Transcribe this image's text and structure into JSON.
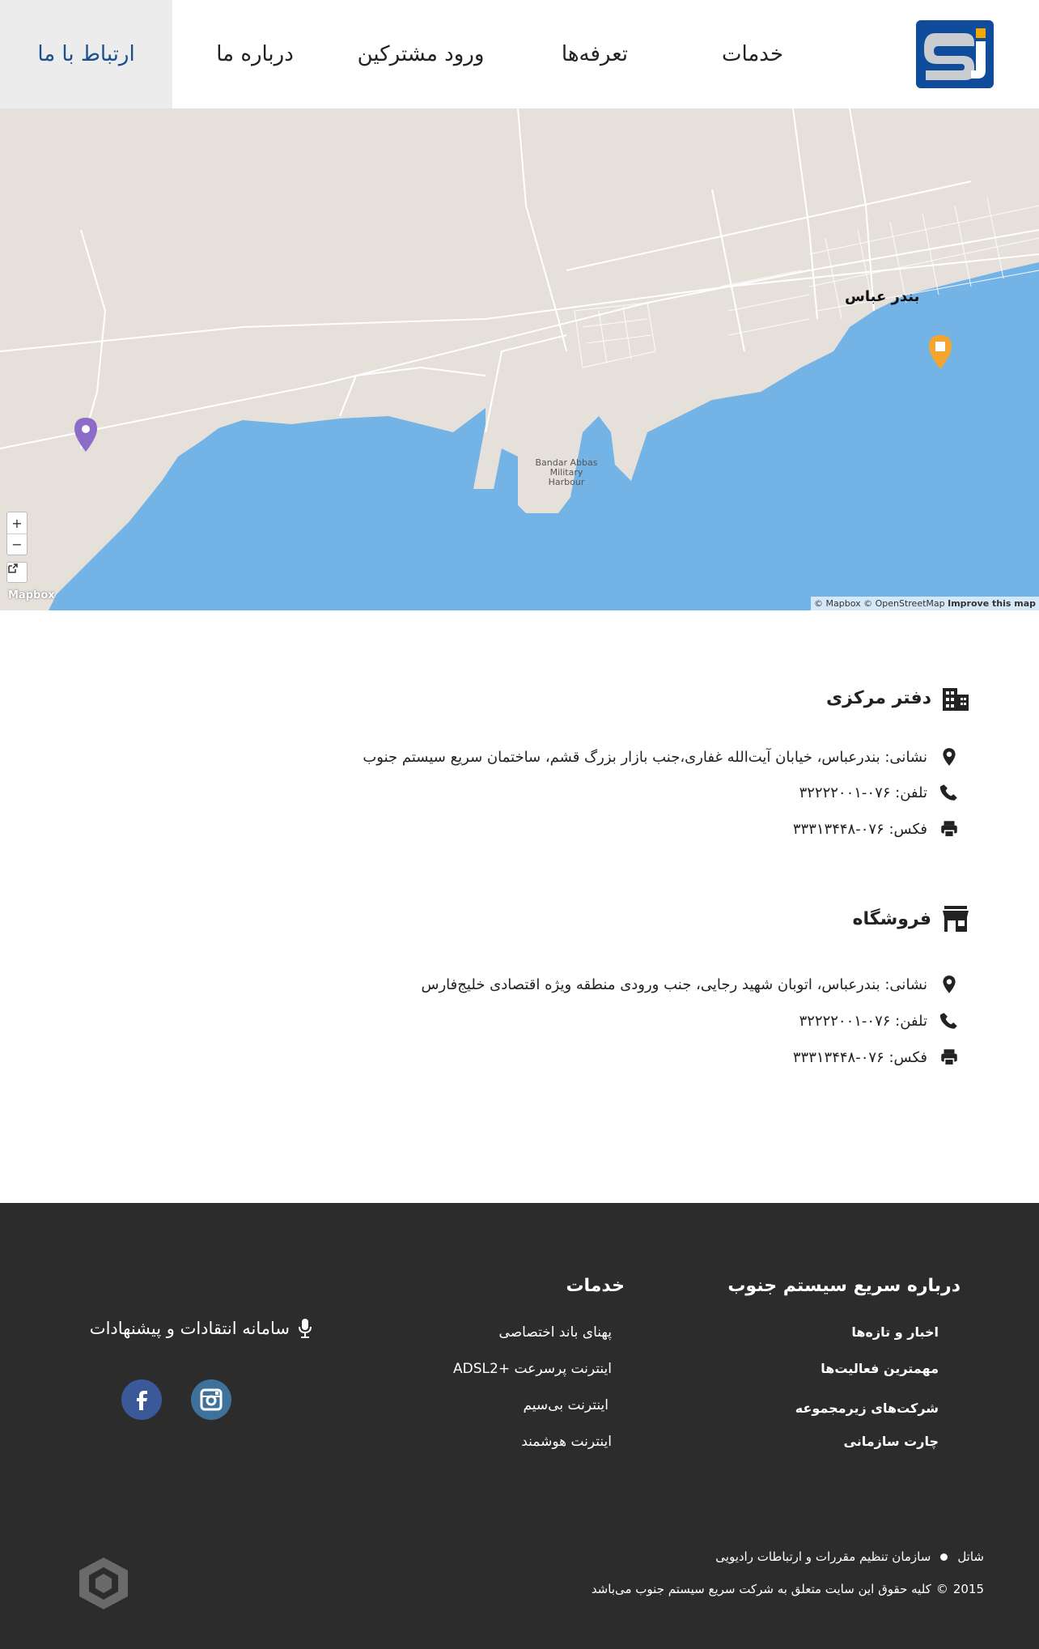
{
  "nav": {
    "items": [
      "ارتباط با ما",
      "درباره ما",
      "ورود مشترکین",
      "تعرفه‌ها",
      "خدمات"
    ],
    "active": "ارتباط با ما"
  },
  "logo": {
    "colors": {
      "bg": "#0f4c9b",
      "accent": "#f2a900"
    }
  },
  "map": {
    "city_label": "بندر عباس",
    "harbour_label": "Bandar Abbas Military Harbour",
    "zoom_in": "+",
    "zoom_out": "−",
    "logo_text": "Mapbox",
    "attribution_mapbox": "© Mapbox",
    "attribution_osm": "© OpenStreetMap",
    "attribution_improve": "Improve this map",
    "colors": {
      "water": "#74b3e6",
      "land": "#e6e0da",
      "roads": "#ffffff",
      "marker_orange": "#f4a530",
      "marker_purple": "#8c6bc9"
    }
  },
  "offices": [
    {
      "title": "دفتر مرکزی",
      "icon": "building-icon",
      "address": "نشانی: بندرعباس، خیابان آیت‌الله غفاری،جنب بازار بزرگ قشم، ساختمان سریع سیستم جنوب",
      "phone": "تلفن: ۰۷۶-۳۲۲۲۲۰۰۱",
      "fax": "فکس: ۰۷۶-۳۳۳۱۳۴۴۸"
    },
    {
      "title": "فروشگاه",
      "icon": "store-icon",
      "address": "نشانی: بندرعباس، اتوبان شهید رجایی، جنب ورودی منطقه ویژه اقتصادی خلیج‌فارس",
      "phone": "تلفن: ۰۷۶-۳۲۲۲۲۰۰۱",
      "fax": "فکس: ۰۷۶-۳۳۳۱۳۴۴۸"
    }
  ],
  "footer": {
    "about_title": "درباره سریع سیستم جنوب",
    "about_links": [
      "اخبار و تازه‌ها",
      "مهمترین فعالیت‌ها",
      "شرکت‌های زیرمجموعه",
      "چارت سازمانی"
    ],
    "services_title": "خدمات",
    "services_links": [
      "پهنای باند اختصاصی",
      "اینترنت پرسرعت +ADSL2",
      "اینترنت بی‌سیم",
      "اینترنت هوشمند"
    ],
    "feedback": "سامانه انتقادات و پیشنهادات",
    "bottom_links": [
      "شاتل",
      "سازمان تنظیم مقررات و ارتباطات رادیویی"
    ],
    "copyright_year": "2015",
    "copyright_symbol": "©",
    "copyright_text": "کلیه حقوق این سایت متعلق به شرکت سریع سیستم جنوب می‌باشد",
    "colors": {
      "bg": "#2c2c2c",
      "facebook": "#3b5998",
      "instagram": "#3f729b"
    }
  }
}
